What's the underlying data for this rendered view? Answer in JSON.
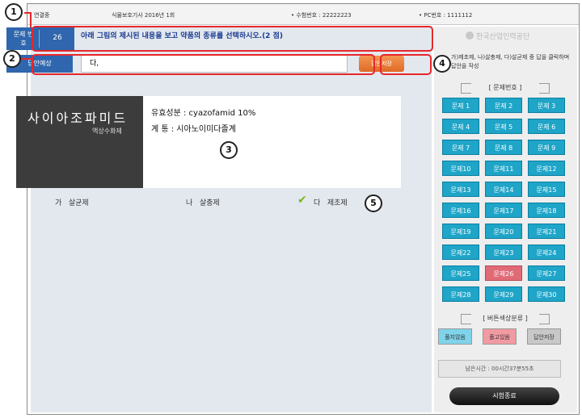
{
  "topbar": {
    "status": "연결중",
    "exam": "식물보호기사 2016년 1회",
    "exam_id": "• 수험번호 : 22222223",
    "pc_id": "• PC번호 : 1111112"
  },
  "question": {
    "number_label": "문제 번호",
    "number_value": "26",
    "text": "아래 그림의 제시된 내용을 보고 약품의 종류를 선택하시오.(2 점)"
  },
  "answer": {
    "label": "답안예상",
    "value": "다,",
    "save_button": "답안저장",
    "hint": "가)제초제, 나)살충제, 다)살균제 중 답을 클릭하며 답안을 작성"
  },
  "product": {
    "name": "사이아조파미드",
    "formulation": "액상수화제",
    "ingredient_line": "유효성분 : cyazofamid 10%",
    "family_line": "계      통 : 시아노이미다졸계"
  },
  "choices": [
    {
      "letter": "가",
      "label": "살균제"
    },
    {
      "letter": "나",
      "label": "살충제"
    },
    {
      "letter": "다",
      "label": "제초제"
    }
  ],
  "sidebar": {
    "logo_text": "한국산업인력공단",
    "grid_title": "[ 문제번호 ]",
    "questions": [
      "문제 1",
      "문제 2",
      "문제 3",
      "문제 4",
      "문제 5",
      "문제 6",
      "문제 7",
      "문제 8",
      "문제 9",
      "문제10",
      "문제11",
      "문제12",
      "문제13",
      "문제14",
      "문제15",
      "문제16",
      "문제17",
      "문제18",
      "문제19",
      "문제20",
      "문제21",
      "문제22",
      "문제23",
      "문제24",
      "문제25",
      "문제26",
      "문제27",
      "문제28",
      "문제29",
      "문제30"
    ],
    "active_question": 26,
    "legend_title": "[ 버튼색상분류 ]",
    "legend": [
      "풀지않음",
      "풀고있음",
      "답안저장"
    ],
    "timer": "남은시간 : 00시간37분55초",
    "end_button": "시험종료"
  },
  "markers": [
    "1",
    "2",
    "3",
    "4",
    "5"
  ],
  "colors": {
    "accent": "#2f66ad",
    "question_button": "#1ea5c8",
    "active_question": "#e06a76",
    "save_button": "#e06a25",
    "annotation": "#e8262b"
  }
}
